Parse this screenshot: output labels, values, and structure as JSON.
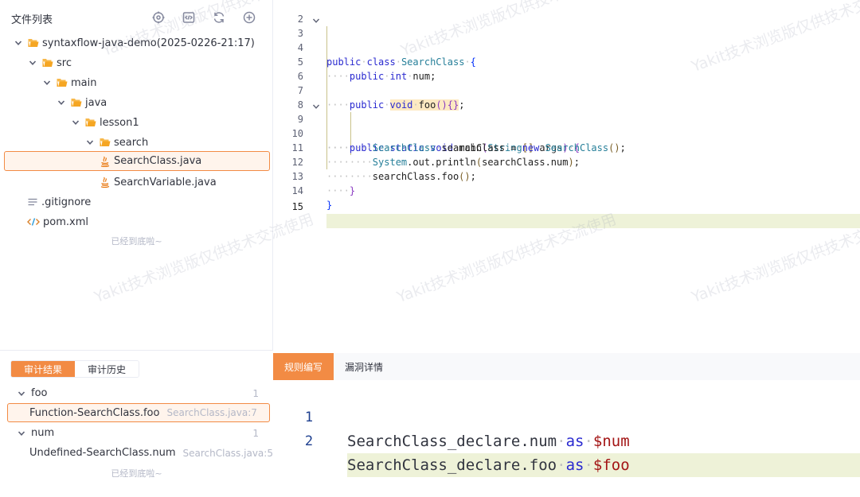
{
  "file_tree": {
    "title": "文件列表",
    "actions": [
      "target-icon",
      "code-icon",
      "refresh-icon",
      "add-icon"
    ],
    "items": [
      {
        "label": "syntaxflow-java-demo(2025-0226-21:17)",
        "type": "folder",
        "depth": 0,
        "expanded": true
      },
      {
        "label": "src",
        "type": "folder",
        "depth": 1,
        "expanded": true
      },
      {
        "label": "main",
        "type": "folder",
        "depth": 2,
        "expanded": true
      },
      {
        "label": "java",
        "type": "folder",
        "depth": 3,
        "expanded": true
      },
      {
        "label": "lesson1",
        "type": "folder",
        "depth": 4,
        "expanded": true
      },
      {
        "label": "search",
        "type": "folder",
        "depth": 5,
        "expanded": true
      },
      {
        "label": "SearchClass.java",
        "type": "java",
        "depth": 6,
        "selected": true
      },
      {
        "label": "SearchVariable.java",
        "type": "java",
        "depth": 6
      },
      {
        "label": ".gitignore",
        "type": "text",
        "depth": 1
      },
      {
        "label": "pom.xml",
        "type": "xml",
        "depth": 1
      }
    ],
    "end_text": "已经到底啦~"
  },
  "audit": {
    "tabs": [
      "审计结果",
      "审计历史"
    ],
    "active_tab": 0,
    "results": [
      {
        "kind": "group",
        "label": "foo",
        "count": "1"
      },
      {
        "kind": "item",
        "label": "Function-SearchClass.foo",
        "location": "SearchClass.java:7",
        "selected": true
      },
      {
        "kind": "group",
        "label": "num",
        "count": "1"
      },
      {
        "kind": "item",
        "label": "Undefined-SearchClass.num",
        "location": "SearchClass.java:5"
      }
    ],
    "end_text": "已经到底啦~"
  },
  "editor": {
    "line_numbers": [
      "2",
      "3",
      "4",
      "5",
      "6",
      "7",
      "8",
      "9",
      "10",
      "11",
      "12",
      "13",
      "14",
      "15"
    ],
    "current_line": "15"
  },
  "bottom_panel": {
    "tabs": [
      "规则编写",
      "漏洞详情"
    ],
    "active_tab": 0,
    "rule_lines": [
      {
        "number": "1",
        "object": "SearchClass_declare.num",
        "keyword": "as",
        "var": "$num"
      },
      {
        "number": "2",
        "object": "SearchClass_declare.foo",
        "keyword": "as",
        "var": "$foo"
      }
    ],
    "current_rule_line": "2"
  },
  "watermark_text": "Yakit技术浏览版仅供技术交流使用",
  "colors": {
    "accent": "#f28b44",
    "selected_bg": "#fff4ec",
    "current_line_bg": "#eef2d8",
    "keyword": "#2a2ad0"
  }
}
